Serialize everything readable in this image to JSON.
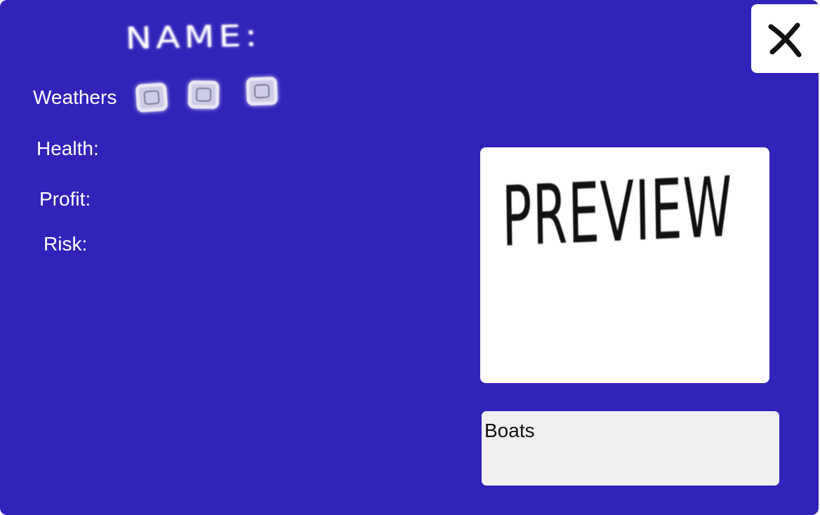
{
  "card": {
    "title": "NAME:",
    "weathers_label": "Weathers",
    "weather_slots": 3,
    "stats": {
      "health_label": "Health:",
      "profit_label": "Profit:",
      "risk_label": "Risk:"
    },
    "preview_text": "PREVIEW",
    "category_label": "Boats",
    "close_icon": "close-icon"
  },
  "colors": {
    "panel_background": "#3023b9",
    "text": "#ffffff",
    "preview_background": "#ffffff",
    "category_background": "#f0f0f0"
  }
}
